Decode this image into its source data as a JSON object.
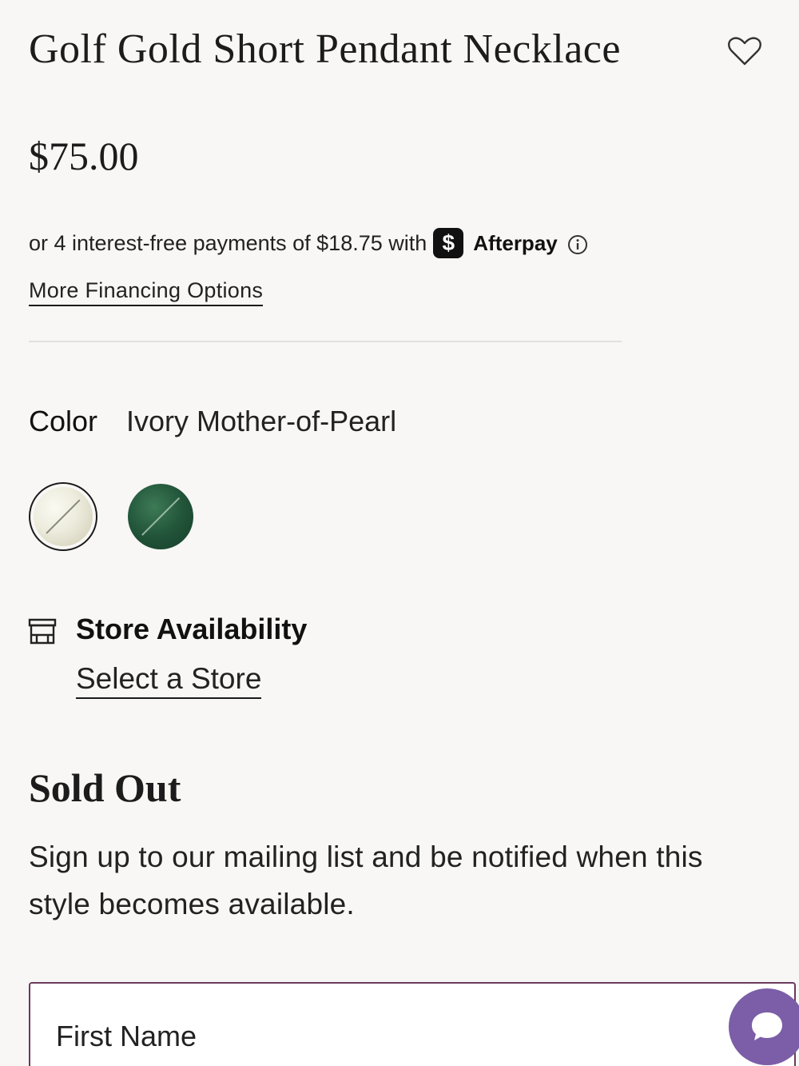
{
  "product": {
    "title": "Golf Gold Short Pendant Necklace",
    "price": "$75.00"
  },
  "afterpay": {
    "text": "or 4 interest-free payments of $18.75 with",
    "badge": "$",
    "brand": "Afterpay",
    "info_icon": "info-icon"
  },
  "financing": {
    "link_label": "More Financing Options"
  },
  "color": {
    "label": "Color",
    "selected": "Ivory Mother-of-Pearl",
    "swatches": [
      {
        "name": "Ivory Mother-of-Pearl",
        "hex": "#ecebdc",
        "selected": true
      },
      {
        "name": "Green",
        "hex": "#22553a",
        "selected": false
      }
    ]
  },
  "store": {
    "icon": "store-icon",
    "title": "Store Availability",
    "link_label": "Select a Store"
  },
  "notify": {
    "heading": "Sold Out",
    "text": "Sign up to our mailing list and be notified when this style becomes available.",
    "first_name_placeholder": "First Name"
  },
  "icons": {
    "wishlist": "heart-icon",
    "chat": "chat-icon"
  },
  "colors": {
    "background": "#f8f7f5",
    "field_border": "#6b3a5c",
    "chat_button": "#7b5ea7"
  }
}
